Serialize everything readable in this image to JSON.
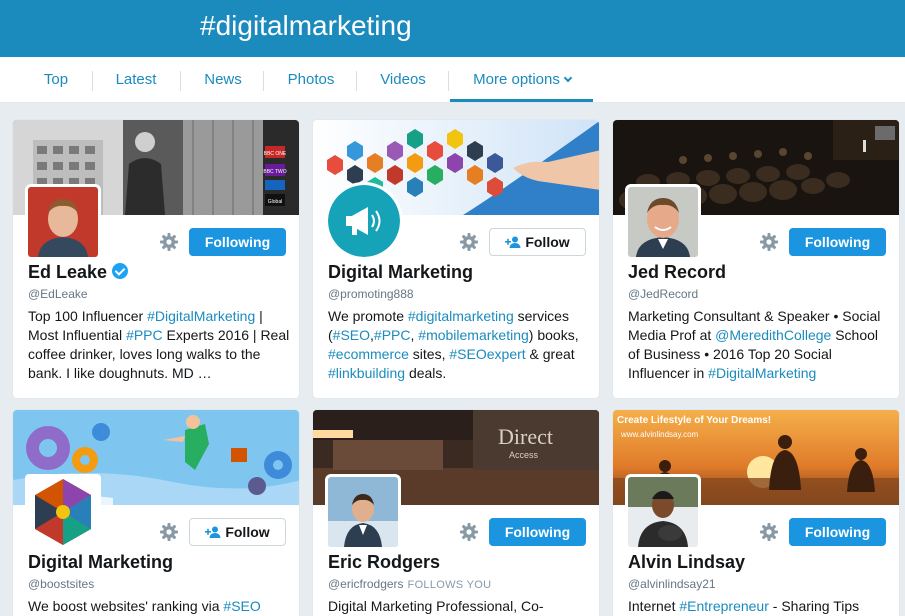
{
  "header": {
    "title": "#digitalmarketing"
  },
  "tabs": [
    {
      "label": "Top"
    },
    {
      "label": "Latest"
    },
    {
      "label": "News"
    },
    {
      "label": "Photos"
    },
    {
      "label": "Videos"
    },
    {
      "label": "More options"
    }
  ],
  "cards": [
    {
      "name": "Ed Leake",
      "handle": "@EdLeake",
      "verified": true,
      "follows_you": "",
      "button": "Following",
      "bio": [
        {
          "t": "Top 100 Influencer "
        },
        {
          "t": "#DigitalMarketing",
          "tag": true
        },
        {
          "t": " | Most Influential "
        },
        {
          "t": "#PPC",
          "tag": true
        },
        {
          "t": " Experts 2016 | Real coffee drinker, loves long walks to the bank. I like doughnuts. MD …"
        }
      ]
    },
    {
      "name": "Digital Marketing",
      "handle": "@promoting888",
      "verified": false,
      "follows_you": "",
      "button": "Follow",
      "bio": [
        {
          "t": "We promote "
        },
        {
          "t": "#digitalmarketing",
          "tag": true
        },
        {
          "t": " services ("
        },
        {
          "t": "#SEO",
          "tag": true
        },
        {
          "t": ","
        },
        {
          "t": "#PPC",
          "tag": true
        },
        {
          "t": ", "
        },
        {
          "t": "#mobilemarketing",
          "tag": true
        },
        {
          "t": ") books, "
        },
        {
          "t": "#ecommerce",
          "tag": true
        },
        {
          "t": " sites, "
        },
        {
          "t": "#SEOexpert",
          "tag": true
        },
        {
          "t": " & great "
        },
        {
          "t": "#linkbuilding",
          "tag": true
        },
        {
          "t": " deals."
        }
      ]
    },
    {
      "name": "Jed Record",
      "handle": "@JedRecord",
      "verified": false,
      "follows_you": "",
      "button": "Following",
      "bio": [
        {
          "t": "Marketing Consultant & Speaker • Social Media Prof at "
        },
        {
          "t": "@MeredithCollege",
          "tag": true
        },
        {
          "t": " School of Business • 2016 Top 20 Social Influencer in "
        },
        {
          "t": "#DigitalMarketing",
          "tag": true
        }
      ]
    },
    {
      "name": "Digital Marketing",
      "handle": "@boostsites",
      "verified": false,
      "follows_you": "",
      "button": "Follow",
      "bio": [
        {
          "t": "We boost websites' ranking via "
        },
        {
          "t": "#SEO",
          "tag": true
        }
      ]
    },
    {
      "name": "Eric Rodgers",
      "handle": "@ericfrodgers",
      "verified": false,
      "follows_you": "FOLLOWS YOU",
      "button": "Following",
      "bio": [
        {
          "t": "Digital Marketing Professional, Co-"
        }
      ]
    },
    {
      "name": "Alvin Lindsay",
      "handle": "@alvinlindsay21",
      "verified": false,
      "follows_you": "",
      "button": "Following",
      "bio": [
        {
          "t": "Internet "
        },
        {
          "t": "#Entrepreneur",
          "tag": true
        },
        {
          "t": " - Sharing Tips"
        }
      ]
    }
  ],
  "banner_texts": {
    "card1_logos": [
      "BBC ONE",
      "BBC TWO",
      "Global"
    ],
    "card5_sign": [
      "Direct",
      "Access"
    ],
    "card6_caption": "Create Lifestyle of Your Dreams!",
    "card6_url": "www.alvinlindsay.com"
  },
  "colors": {
    "accent": "#1b8bbe",
    "following_button": "#1b95e0",
    "header_bg": "#1b8bbe",
    "page_bg": "#e6ecf0"
  }
}
